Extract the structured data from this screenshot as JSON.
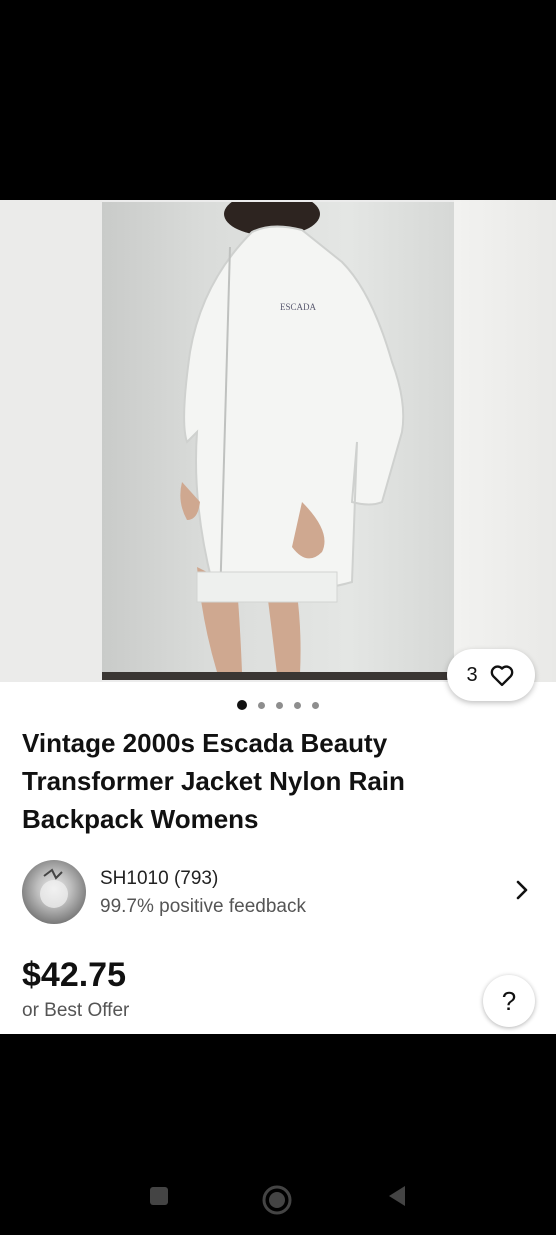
{
  "listing": {
    "watch_count": "3",
    "title": "Vintage 2000s Escada Beauty Transformer Jacket Nylon Rain Backpack Womens",
    "image_logo_text": "ESCADA",
    "carousel_total": 5,
    "carousel_active": 1
  },
  "seller": {
    "name": "SH1010 (793)",
    "feedback": "99.7% positive feedback"
  },
  "pricing": {
    "price": "$42.75",
    "offer_text": "or Best Offer"
  },
  "help": {
    "label": "?"
  },
  "icons": {
    "heart": "heart-icon",
    "chevron": "chevron-right-icon",
    "nav_recents": "recents-square-icon",
    "nav_home": "home-circle-icon",
    "nav_back": "back-triangle-icon"
  },
  "colors": {
    "accent": "#111111",
    "muted": "#555555",
    "background": "#ffffff"
  }
}
